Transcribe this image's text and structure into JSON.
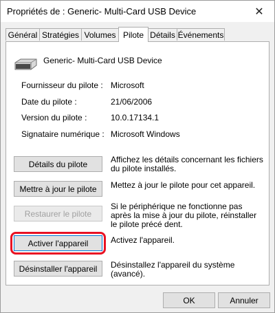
{
  "window": {
    "title": "Propriétés de : Generic- Multi-Card USB Device",
    "close_glyph": "✕"
  },
  "tabs": [
    {
      "label": "Général"
    },
    {
      "label": "Stratégies"
    },
    {
      "label": "Volumes"
    },
    {
      "label": "Pilote"
    },
    {
      "label": "Détails"
    },
    {
      "label": "Événements"
    }
  ],
  "active_tab": "Pilote",
  "device": {
    "icon": "usb-drive-icon",
    "name": "Generic- Multi-Card USB Device"
  },
  "driver_info": [
    {
      "label": "Fournisseur du pilote :",
      "value": "Microsoft"
    },
    {
      "label": "Date du pilote :",
      "value": "21/06/2006"
    },
    {
      "label": "Version du pilote :",
      "value": "10.0.17134.1"
    },
    {
      "label": "Signataire numérique :",
      "value": "Microsoft Windows"
    }
  ],
  "actions": [
    {
      "label": "Détails du pilote",
      "description": "Affichez les détails concernant les fichiers du pilote installés.",
      "enabled": true
    },
    {
      "label": "Mettre à jour le pilote",
      "description": "Mettez à jour le pilote pour cet appareil.",
      "enabled": true
    },
    {
      "label": "Restaurer le pilote",
      "description": "Si le périphérique ne fonctionne pas après la mise à jour du pilote, réinstaller le pilote précé dent.",
      "enabled": false
    },
    {
      "label": "Activer l'appareil",
      "description": "Activez l'appareil.",
      "enabled": true,
      "highlighted": true
    },
    {
      "label": "Désinstaller l'appareil",
      "description": "Désinstallez l'appareil du système (avancé).",
      "enabled": true
    }
  ],
  "footer": {
    "ok_label": "OK",
    "cancel_label": "Annuler"
  },
  "colors": {
    "highlight": "#e81123",
    "focus": "#0078d7"
  }
}
